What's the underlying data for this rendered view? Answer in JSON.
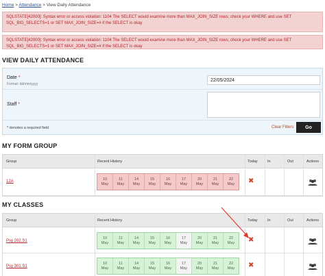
{
  "breadcrumb": {
    "home": "Home",
    "sep1": " > ",
    "attendance": "Attendance",
    "sep2": " > ",
    "current": "View Daily Attendance"
  },
  "errors": [
    "SQLSTATE[42000]: Syntax error or access violation: 1104 The SELECT would examine more than MAX_JOIN_SIZE rows; check your WHERE and use SET SQL_BIG_SELECTS=1 or SET MAX_JOIN_SIZE=# if the SELECT is okay",
    "SQLSTATE[42000]: Syntax error or access violation: 1104 The SELECT would examine more than MAX_JOIN_SIZE rows; check your WHERE and use SET SQL_BIG_SELECTS=1 or SET MAX_JOIN_SIZE=# if the SELECT is okay"
  ],
  "page_title": "VIEW DAILY ATTENDANCE",
  "filters": {
    "date_label": "Date",
    "date_required": "*",
    "date_hint": "Format: dd/mm/yyyy",
    "date_value": "22/05/2024",
    "staff_label": "Staff",
    "staff_required": "*",
    "required_note": "* denotes a required field",
    "clear_label": "Clear Filters",
    "go_label": "Go"
  },
  "columns": {
    "group": "Group",
    "history": "Recent History",
    "today": "Today",
    "in": "In",
    "out": "Out",
    "actions": "Actions"
  },
  "form_group": {
    "heading": "MY FORM GROUP",
    "rows": [
      {
        "group": "12A",
        "history": [
          {
            "day": "10",
            "month": "May",
            "state": "red"
          },
          {
            "day": "11",
            "month": "May",
            "state": "red"
          },
          {
            "day": "14",
            "month": "May",
            "state": "red"
          },
          {
            "day": "15",
            "month": "May",
            "state": "red"
          },
          {
            "day": "16",
            "month": "May",
            "state": "red"
          },
          {
            "day": "17",
            "month": "May",
            "state": "red"
          },
          {
            "day": "20",
            "month": "May",
            "state": "red"
          },
          {
            "day": "21",
            "month": "May",
            "state": "red"
          },
          {
            "day": "22",
            "month": "May",
            "state": "red"
          }
        ]
      }
    ]
  },
  "classes": {
    "heading": "MY CLASSES",
    "rows": [
      {
        "group": "Psy 202.S1",
        "history": [
          {
            "day": "10",
            "month": "May",
            "state": "green"
          },
          {
            "day": "11",
            "month": "May",
            "state": "green"
          },
          {
            "day": "14",
            "month": "May",
            "state": "green"
          },
          {
            "day": "15",
            "month": "May",
            "state": "green"
          },
          {
            "day": "16",
            "month": "May",
            "state": "green"
          },
          {
            "day": "17",
            "month": "May",
            "state": "blank"
          },
          {
            "day": "20",
            "month": "May",
            "state": "green"
          },
          {
            "day": "21",
            "month": "May",
            "state": "green"
          },
          {
            "day": "22",
            "month": "May",
            "state": "green"
          }
        ]
      },
      {
        "group": "Psy 301.S1",
        "history": [
          {
            "day": "10",
            "month": "May",
            "state": "green"
          },
          {
            "day": "11",
            "month": "May",
            "state": "green"
          },
          {
            "day": "14",
            "month": "May",
            "state": "green"
          },
          {
            "day": "15",
            "month": "May",
            "state": "green"
          },
          {
            "day": "16",
            "month": "May",
            "state": "green"
          },
          {
            "day": "17",
            "month": "May",
            "state": "blank"
          },
          {
            "day": "20",
            "month": "May",
            "state": "green"
          },
          {
            "day": "21",
            "month": "May",
            "state": "green"
          },
          {
            "day": "22",
            "month": "May",
            "state": "green"
          }
        ]
      }
    ]
  },
  "icons": {
    "today": "close-icon",
    "actions": "people-icon",
    "annotation": "arrow-annotation"
  },
  "colors": {
    "error_bg": "#f3d2d2",
    "error_text": "#b0232a",
    "present": "#d7f3d7",
    "absent": "#f3c9c9",
    "cross": "#d2432a",
    "arrow": "#e0392b"
  }
}
